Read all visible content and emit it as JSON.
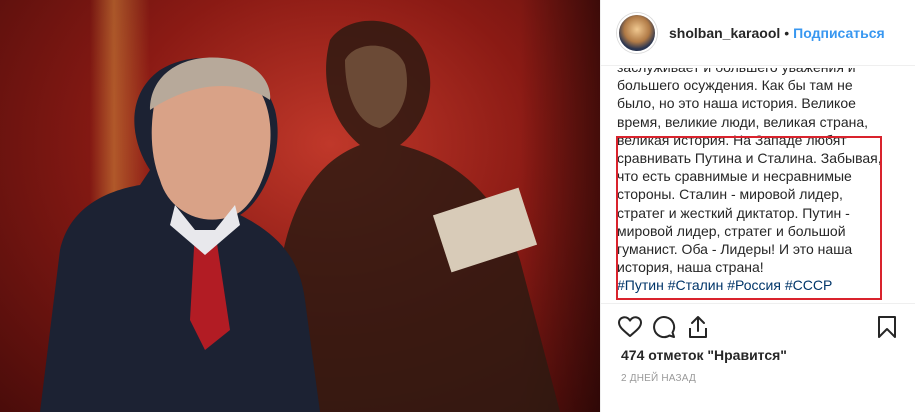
{
  "post": {
    "photo_alt": "photo",
    "user": {
      "username": "sholban_karaool",
      "separator": "•",
      "follow_label": "Подписаться"
    },
    "caption": {
      "lines": [
        "заслуживает и большего уважения и",
        "большего осуждения. Как бы там не",
        "было, но это наша история. Великое",
        "время, великие люди, великая страна,",
        "великая история. На Западе любят",
        "сравнивать Путина и Сталина. Забывая,",
        "что есть сравнимые и несравнимые",
        "стороны. Сталин - мировой лидер,",
        "стратег и жесткий диктатор. Путин -",
        "мировой лидер, стратег и большой",
        "гуманист. Оба - Лидеры! И это наша",
        "история, наша страна!"
      ],
      "hashtags": [
        "#Путин",
        "#Сталин",
        "#Россия",
        "#СССР"
      ]
    },
    "actions": {
      "like_icon": "heart-icon",
      "comment_icon": "comment-icon",
      "share_icon": "share-icon",
      "save_icon": "bookmark-icon"
    },
    "likes_text": "474 отметок \"Нравится\"",
    "timestamp": "2 дней назад",
    "colors": {
      "link_blue": "#3897f0",
      "hashtag": "#003569",
      "highlight_box": "#d9232d",
      "muted": "#999999"
    }
  }
}
